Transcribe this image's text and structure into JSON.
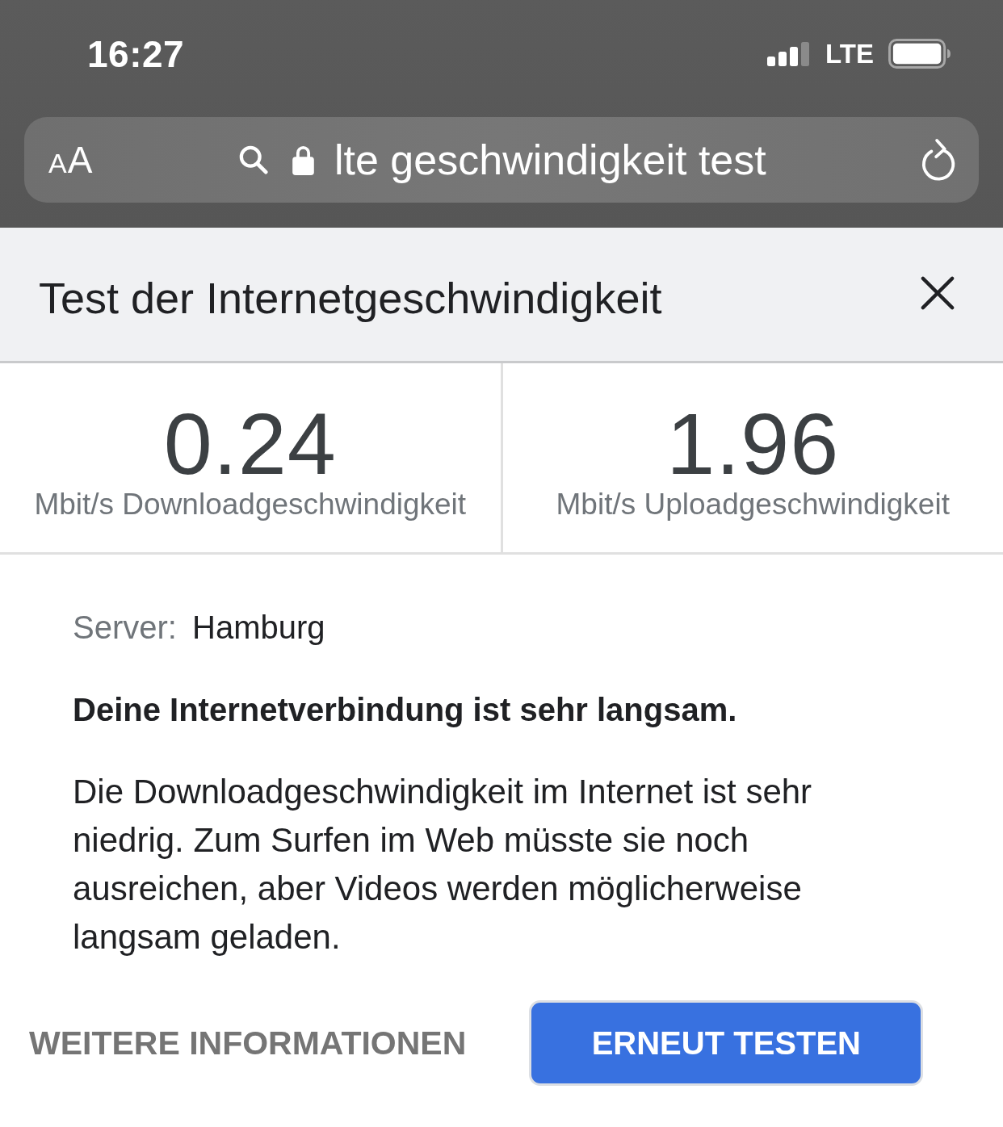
{
  "status_bar": {
    "time": "16:27",
    "network": "LTE"
  },
  "address_bar": {
    "text_size_label": "AA",
    "url": "lte geschwindigkeit test"
  },
  "dialog": {
    "title": "Test der Internetgeschwindigkeit"
  },
  "results": [
    {
      "value": "0.24",
      "label": "Mbit/s Downloadgeschwindigkeit"
    },
    {
      "value": "1.96",
      "label": "Mbit/s Uploadgeschwindigkeit"
    }
  ],
  "server": {
    "label": "Server:",
    "value": "Hamburg"
  },
  "verdict": "Deine Internetverbindung ist sehr langsam.",
  "description": "Die Downloadgeschwindigkeit im Internet ist sehr niedrig. Zum Surfen im Web müsste sie noch ausreichen, aber Videos werden möglicherweise langsam geladen.",
  "actions": [
    {
      "label": "WEITERE INFORMATIONEN",
      "kind": "link"
    },
    {
      "label": "ERNEUT TESTEN",
      "kind": "primary"
    }
  ]
}
